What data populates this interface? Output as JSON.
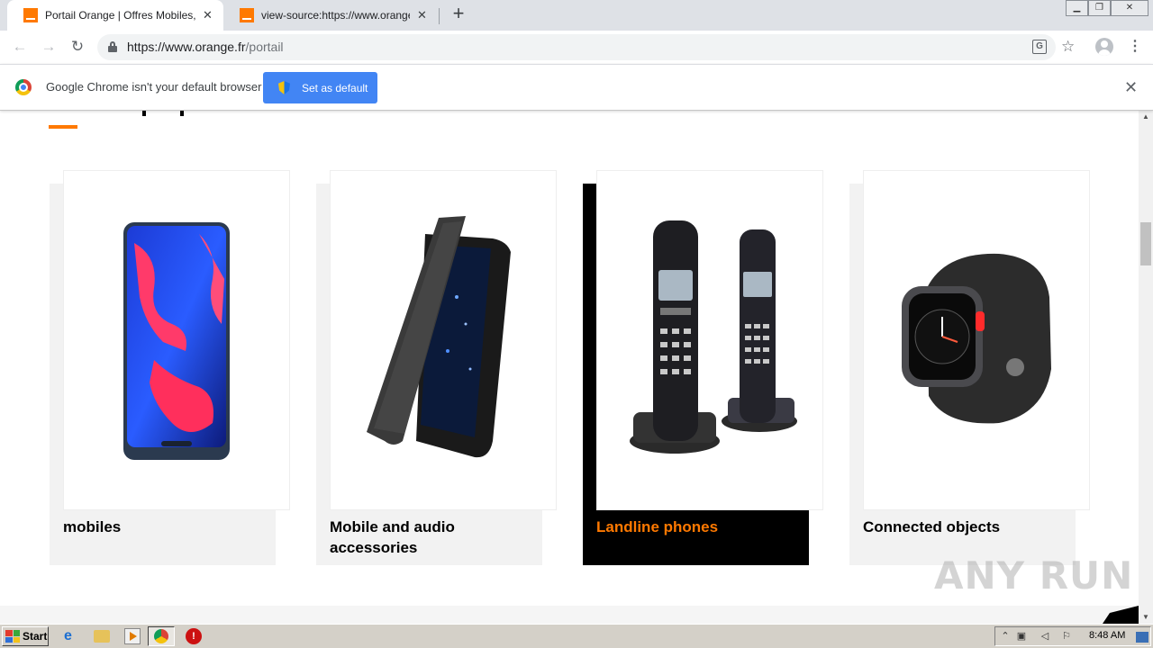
{
  "browser": {
    "tabs": [
      {
        "title": "Portail Orange | Offres Mobiles, Inte",
        "active": true
      },
      {
        "title": "view-source:https://www.orange.fr",
        "active": false
      }
    ],
    "url_host": "https://www.orange.fr",
    "url_path": "/portail"
  },
  "infobar": {
    "message": "Google Chrome isn't your default browser",
    "button_label": "Set as default"
  },
  "page": {
    "accent_color": "#ff7900",
    "cards": [
      {
        "label": "mobiles",
        "active": false
      },
      {
        "label": "Mobile and audio accessories",
        "active": false
      },
      {
        "label": "Landline phones",
        "active": true
      },
      {
        "label": "Connected objects",
        "active": false
      }
    ]
  },
  "watermark": "ANY RUN",
  "taskbar": {
    "start_label": "Start",
    "clock": "8:48 AM"
  }
}
